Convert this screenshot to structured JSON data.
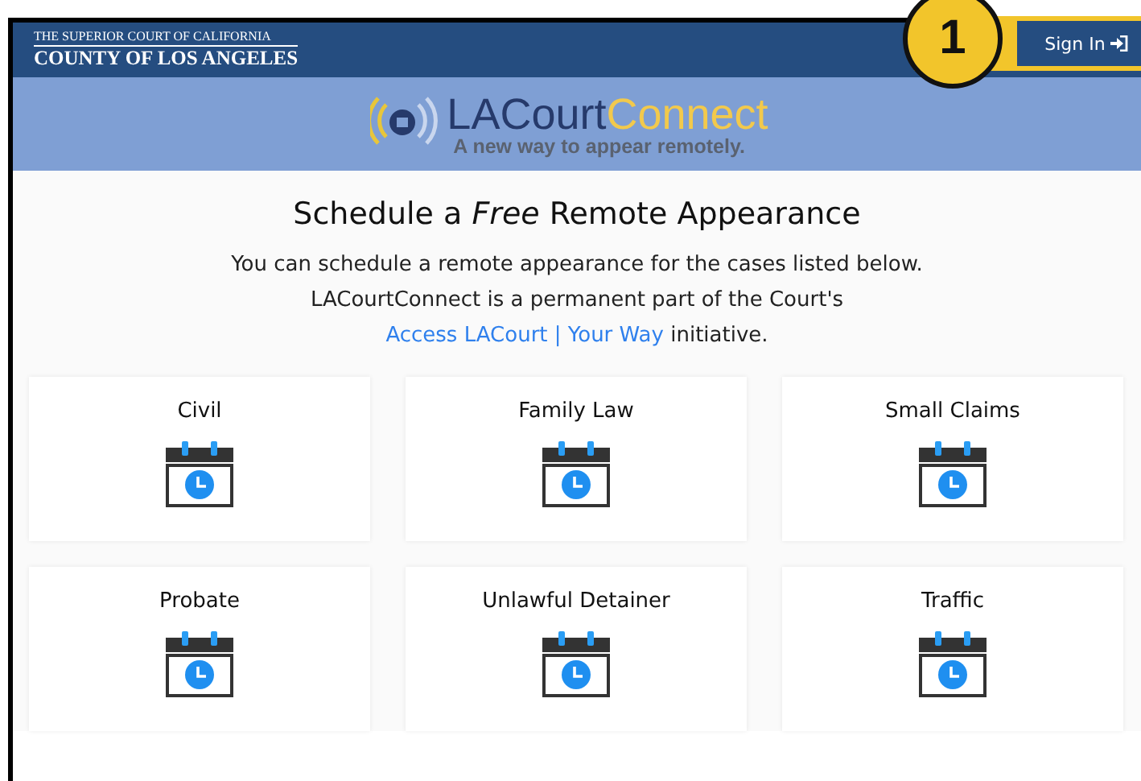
{
  "header": {
    "court_line1": "THE SUPERIOR COURT OF CALIFORNIA",
    "court_line2": "COUNTY OF LOS ANGELES",
    "sign_in": "Sign In",
    "callout": "1"
  },
  "banner": {
    "brand_part1": "LACourt",
    "brand_part2": "Connect",
    "tagline": "A new way to appear remotely."
  },
  "heading": "Schedule a *Free* Remote Appearance",
  "intro": {
    "line1": "You can schedule a remote appearance for the cases listed below.",
    "line2": "LACourtConnect is a permanent part of the Court's",
    "link": "Access LACourt | Your Way",
    "after": "initiative."
  },
  "case_types": [
    {
      "label": "Civil"
    },
    {
      "label": "Family Law"
    },
    {
      "label": "Small Claims"
    },
    {
      "label": "Probate"
    },
    {
      "label": "Unlawful Detainer"
    },
    {
      "label": "Traffic"
    }
  ]
}
